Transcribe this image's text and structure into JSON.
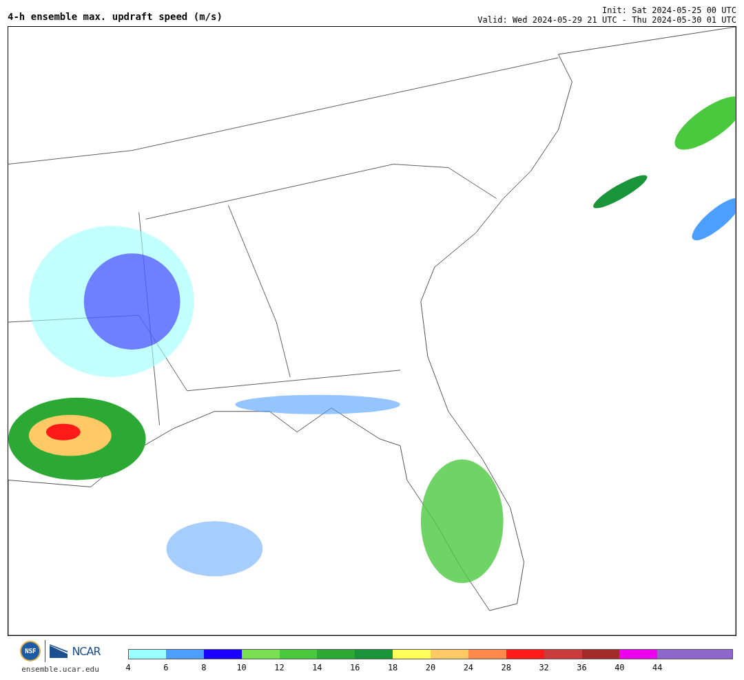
{
  "header": {
    "title": "4-h ensemble max. updraft speed (m/s)",
    "init": "Init: Sat 2024-05-25 00 UTC",
    "valid": "Valid: Wed 2024-05-29 21 UTC - Thu 2024-05-30 01 UTC"
  },
  "footer": {
    "nsf_logo": "NSF",
    "ncar_logo": "NCAR",
    "url": "ensemble.ucar.edu"
  },
  "colorbar": {
    "bins": [
      {
        "color": "#99ffff",
        "label": "4"
      },
      {
        "color": "#4c9eff",
        "label": "6"
      },
      {
        "color": "#1a00ff",
        "label": "8"
      },
      {
        "color": "#79e052",
        "label": "10"
      },
      {
        "color": "#4bc93e",
        "label": "12"
      },
      {
        "color": "#2ba934",
        "label": "14"
      },
      {
        "color": "#1a9438",
        "label": "16"
      },
      {
        "color": "#ffff59",
        "label": "18"
      },
      {
        "color": "#ffc966",
        "label": "20"
      },
      {
        "color": "#ff884d",
        "label": "24"
      },
      {
        "color": "#ff1a1a",
        "label": "28"
      },
      {
        "color": "#cc3b3b",
        "label": "32"
      },
      {
        "color": "#a32b2b",
        "label": "36"
      },
      {
        "color": "#ee00ee",
        "label": "40"
      },
      {
        "color": "#8f66cc",
        "label": "44"
      },
      {
        "color": "#8f66cc"
      }
    ]
  }
}
